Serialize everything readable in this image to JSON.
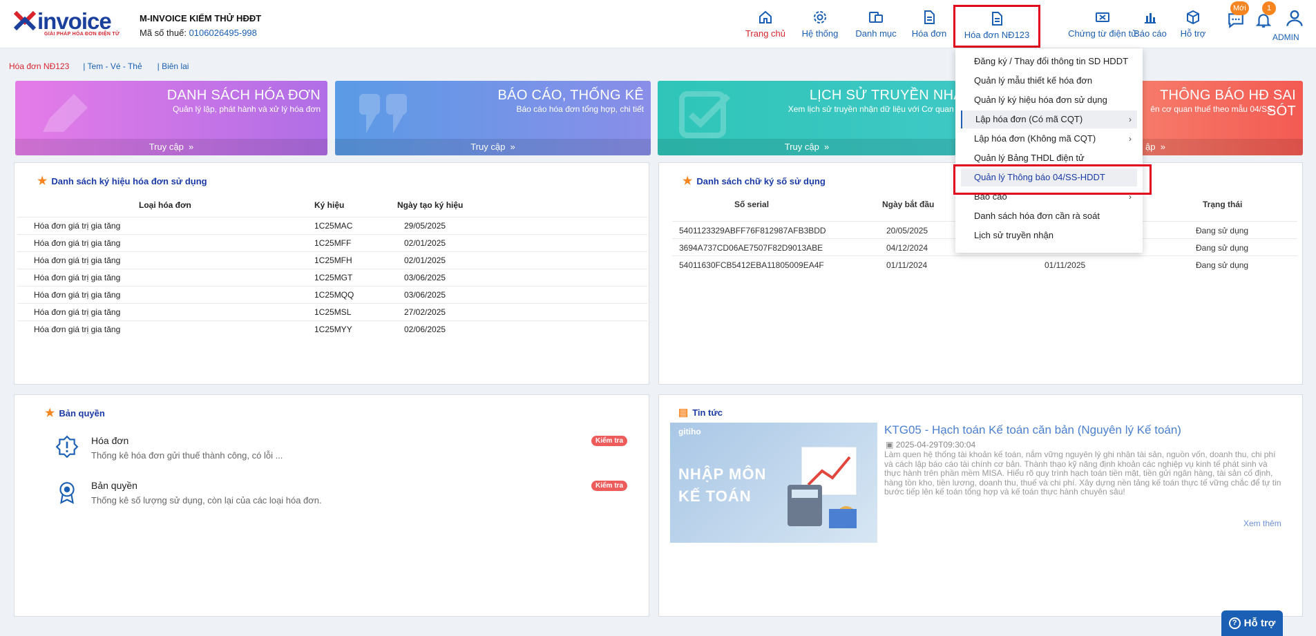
{
  "brand": {
    "name": "invoice",
    "tagline": "GIẢI PHÁP HÓA ĐƠN ĐIỆN TỬ",
    "company": "M-INVOICE KIỂM THỬ HĐĐT",
    "tax_label": "Mã số thuế:",
    "tax_value": "0106026495-998"
  },
  "nav": [
    {
      "label": "Trang chủ",
      "icon": "home-icon"
    },
    {
      "label": "Hệ thống",
      "icon": "gear-icon"
    },
    {
      "label": "Danh mục",
      "icon": "folder-icon"
    },
    {
      "label": "Hóa đơn",
      "icon": "document-icon"
    },
    {
      "label": "Hóa đơn NĐ123",
      "icon": "document-icon"
    },
    {
      "label": "Chứng từ điện tử",
      "icon": "ticket-icon"
    },
    {
      "label": "Báo cáo",
      "icon": "bar-chart-icon"
    },
    {
      "label": "Hỗ trợ",
      "icon": "box-icon"
    }
  ],
  "badges": {
    "new": "Mới",
    "notifications": "1"
  },
  "user": "ADMIN",
  "breadcrumbs": [
    "Hóa đơn NĐ123",
    "| Tem - Vé - Thẻ",
    "| Biên lai"
  ],
  "banners": [
    {
      "title": "DANH SÁCH HÓA ĐƠN",
      "subtitle": "Quản lý lập, phát hành và xử lý hóa đơn",
      "action": "Truy cập"
    },
    {
      "title": "BÁO CÁO, THỐNG KÊ",
      "subtitle": "Báo cáo hóa đơn tổng hợp, chi tiết",
      "action": "Truy cập"
    },
    {
      "title": "LỊCH SỬ TRUYỀN NHẬ",
      "subtitle": "Xem lịch sử truyền nhận dữ liệu với Cơ quan th",
      "action": "Truy cập"
    },
    {
      "title": "THÔNG BÁO HĐ SAI SÓT",
      "subtitle": "ên cơ quan thuế theo mẫu 04/SS-",
      "action": "ập"
    }
  ],
  "symbols_panel": {
    "title": "Danh sách ký hiệu hóa đơn sử dụng",
    "columns": [
      "Loại hóa đơn",
      "Ký hiệu",
      "Ngày tạo ký hiệu"
    ],
    "rows": [
      [
        "Hóa đơn giá trị gia tăng",
        "1C25MAC",
        "29/05/2025"
      ],
      [
        "Hóa đơn giá trị gia tăng",
        "1C25MFF",
        "02/01/2025"
      ],
      [
        "Hóa đơn giá trị gia tăng",
        "1C25MFH",
        "02/01/2025"
      ],
      [
        "Hóa đơn giá trị gia tăng",
        "1C25MGT",
        "03/06/2025"
      ],
      [
        "Hóa đơn giá trị gia tăng",
        "1C25MQQ",
        "03/06/2025"
      ],
      [
        "Hóa đơn giá trị gia tăng",
        "1C25MSL",
        "27/02/2025"
      ],
      [
        "Hóa đơn giá trị gia tăng",
        "1C25MYY",
        "02/06/2025"
      ]
    ]
  },
  "signature_panel": {
    "title": "Danh sách chữ ký số sử dụng",
    "columns": [
      "Số serial",
      "Ngày bắt đầu",
      "Trạng thái"
    ],
    "rows": [
      [
        "5401123329ABFF76F812987AFB3BDD",
        "20/05/2025",
        "",
        "Đang sử dụng"
      ],
      [
        "3694A737CD06AE7507F82D9013ABE",
        "04/12/2024",
        "",
        "Đang sử dụng"
      ],
      [
        "54011630FCB5412EBA11805009EA4F",
        "01/11/2024",
        "01/11/2025",
        "Đang sử dụng"
      ]
    ]
  },
  "dropdown": [
    {
      "label": "Đăng ký / Thay đổi thông tin SD HDDT",
      "submenu": false
    },
    {
      "label": "Quản lý mẫu thiết kế hóa đơn",
      "submenu": false
    },
    {
      "label": "Quản lý ký hiệu hóa đơn sử dụng",
      "submenu": false
    },
    {
      "label": "Lập hóa đơn (Có mã CQT)",
      "submenu": true
    },
    {
      "label": "Lập hóa đơn (Không mã CQT)",
      "submenu": true
    },
    {
      "label": "Quản lý Bảng THDL điện tử",
      "submenu": false
    },
    {
      "label": "Quản lý Thông báo 04/SS-HDDT",
      "submenu": false
    },
    {
      "label": "Báo cáo",
      "submenu": true
    },
    {
      "label": "Danh sách hóa đơn cần rà soát",
      "submenu": false
    },
    {
      "label": "Lịch sử truyền nhận",
      "submenu": false
    }
  ],
  "license_panel": {
    "title": "Bản quyền",
    "items": [
      {
        "title": "Hóa đơn",
        "desc": "Thống kê hóa đơn gửi thuế thành công, có lỗi ...",
        "action": "Kiểm tra"
      },
      {
        "title": "Bản quyền",
        "desc": "Thống kê số lượng sử dụng, còn lại của các loại hóa đơn.",
        "action": "Kiểm tra"
      }
    ]
  },
  "news_panel": {
    "title": "Tin tức",
    "image_brand": "gitiho",
    "image_line1": "NHẬP MÔN",
    "image_line2": "KẾ TOÁN",
    "article_title": "KTG05 - Hạch toán Kế toán căn bản (Nguyên lý Kế toán)",
    "article_date": "2025-04-29T09:30:04",
    "article_desc": "Làm quen hệ thống tài khoản kế toán, nắm vững nguyên lý ghi nhận tài sản, nguồn vốn, doanh thu, chi phí và cách lập báo cáo tài chính cơ bản. Thành thạo kỹ năng định khoản các nghiệp vụ kinh tế phát sinh và thực hành trên phần mềm MISA. Hiểu rõ quy trình hạch toán tiền mặt, tiền gửi ngân hàng, tài sản cố định, hàng tồn kho, tiền lương, doanh thu, thuế và chi phí. Xây dựng nền tảng kế toán thực tế vững chắc để tự tin bước tiếp lên kế toán tổng hợp và kế toán thực hành chuyên sâu!",
    "more": "Xem thêm"
  },
  "support_label": "Hỗ trợ"
}
